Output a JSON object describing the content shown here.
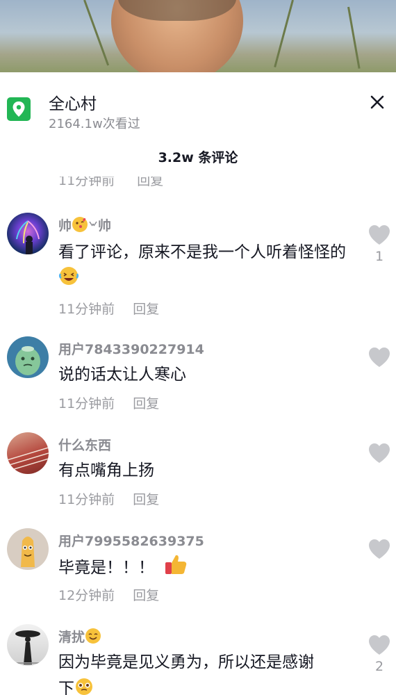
{
  "location": {
    "title": "全心村",
    "views": "2164.1w次看过"
  },
  "comment_count": "3.2w 条评论",
  "prev_comment_meta": {
    "time": "11分钟前",
    "reply": "回复"
  },
  "comments": [
    {
      "name_a": "帅",
      "name_b": "帅",
      "text": "看了评论，原来不是我一个人听着怪怪的",
      "time": "11分钟前",
      "reply": "回复",
      "likes": "1"
    },
    {
      "name": "用户7843390227914",
      "text": "说的话太让人寒心",
      "time": "11分钟前",
      "reply": "回复"
    },
    {
      "name": "什么东西",
      "text": "有点嘴角上扬",
      "time": "11分钟前",
      "reply": "回复"
    },
    {
      "name": "用户7995582639375",
      "text": "毕竟是！！！",
      "time": "12分钟前",
      "reply": "回复"
    },
    {
      "name": "清扰",
      "text_a": "因为毕竟是见义勇为，所以还是感谢",
      "text_b": "下",
      "likes": "2"
    }
  ],
  "colors": {
    "accent": "#22b655",
    "text": "#161823",
    "secondary": "#8a8b91",
    "like_gray": "#c7c8cc"
  },
  "icons": [
    "location-pin-icon",
    "close-icon",
    "heart-icon",
    "kiss-emoji-icon",
    "laugh-emoji-icon",
    "thumbs-up-emoji-icon",
    "smile-emoji-icon",
    "pleading-emoji-icon"
  ]
}
